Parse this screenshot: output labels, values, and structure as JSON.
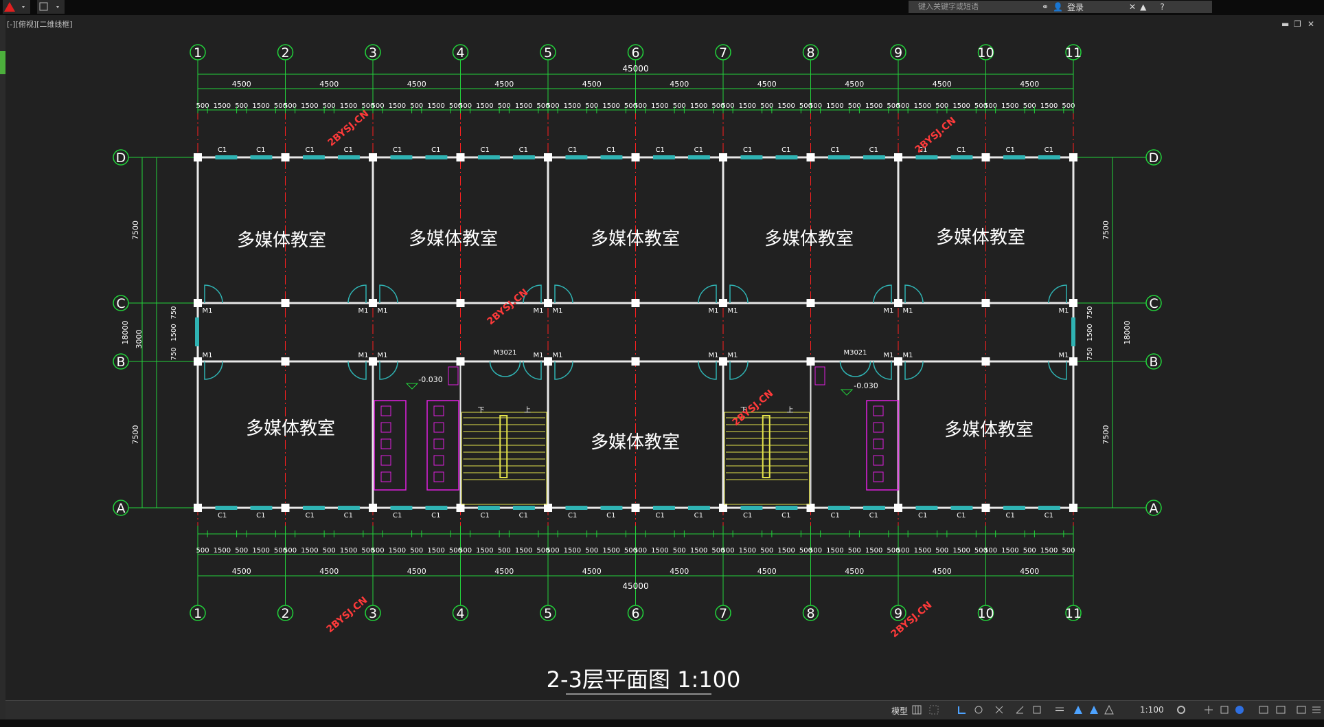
{
  "app": {
    "viewport_label": "[-][俯视][二维线框]",
    "search_placeholder": "键入关键字或短语",
    "login_label": "登录"
  },
  "plan": {
    "title": "2-3层平面图 1:100",
    "axis_numbers": [
      "1",
      "2",
      "3",
      "4",
      "5",
      "6",
      "7",
      "8",
      "9",
      "10",
      "11"
    ],
    "axis_letters": [
      "D",
      "C",
      "B",
      "A"
    ],
    "overall_dim": "45000",
    "bay_dim": "4500",
    "sub_dims": [
      "500",
      "1500",
      "500",
      "1500",
      "500"
    ],
    "left_dims": {
      "total": "18000",
      "d_c": "7500",
      "c_b": "3000",
      "b_a": "7500",
      "corr_a": "750",
      "corr_b": "1500",
      "corr_c": "750"
    },
    "room_label": "多媒体教室",
    "window_label": "C1",
    "door_label": "M1",
    "double_door_label": "M3021",
    "level_label": "-0.030",
    "stair_down": "下",
    "stair_up": "上",
    "watermark": "2BYSJ.CN"
  },
  "status": {
    "model_label": "模型",
    "scale_label": "1:100"
  },
  "colors": {
    "background": "#212121",
    "axis_line": "#ff2020",
    "dim_line": "#22d33b",
    "wall": "#e8e8e8",
    "window": "#2fb3b3",
    "stair": "#e3e24a",
    "toilet": "#e020e0",
    "watermark": "#ff3a3a"
  }
}
